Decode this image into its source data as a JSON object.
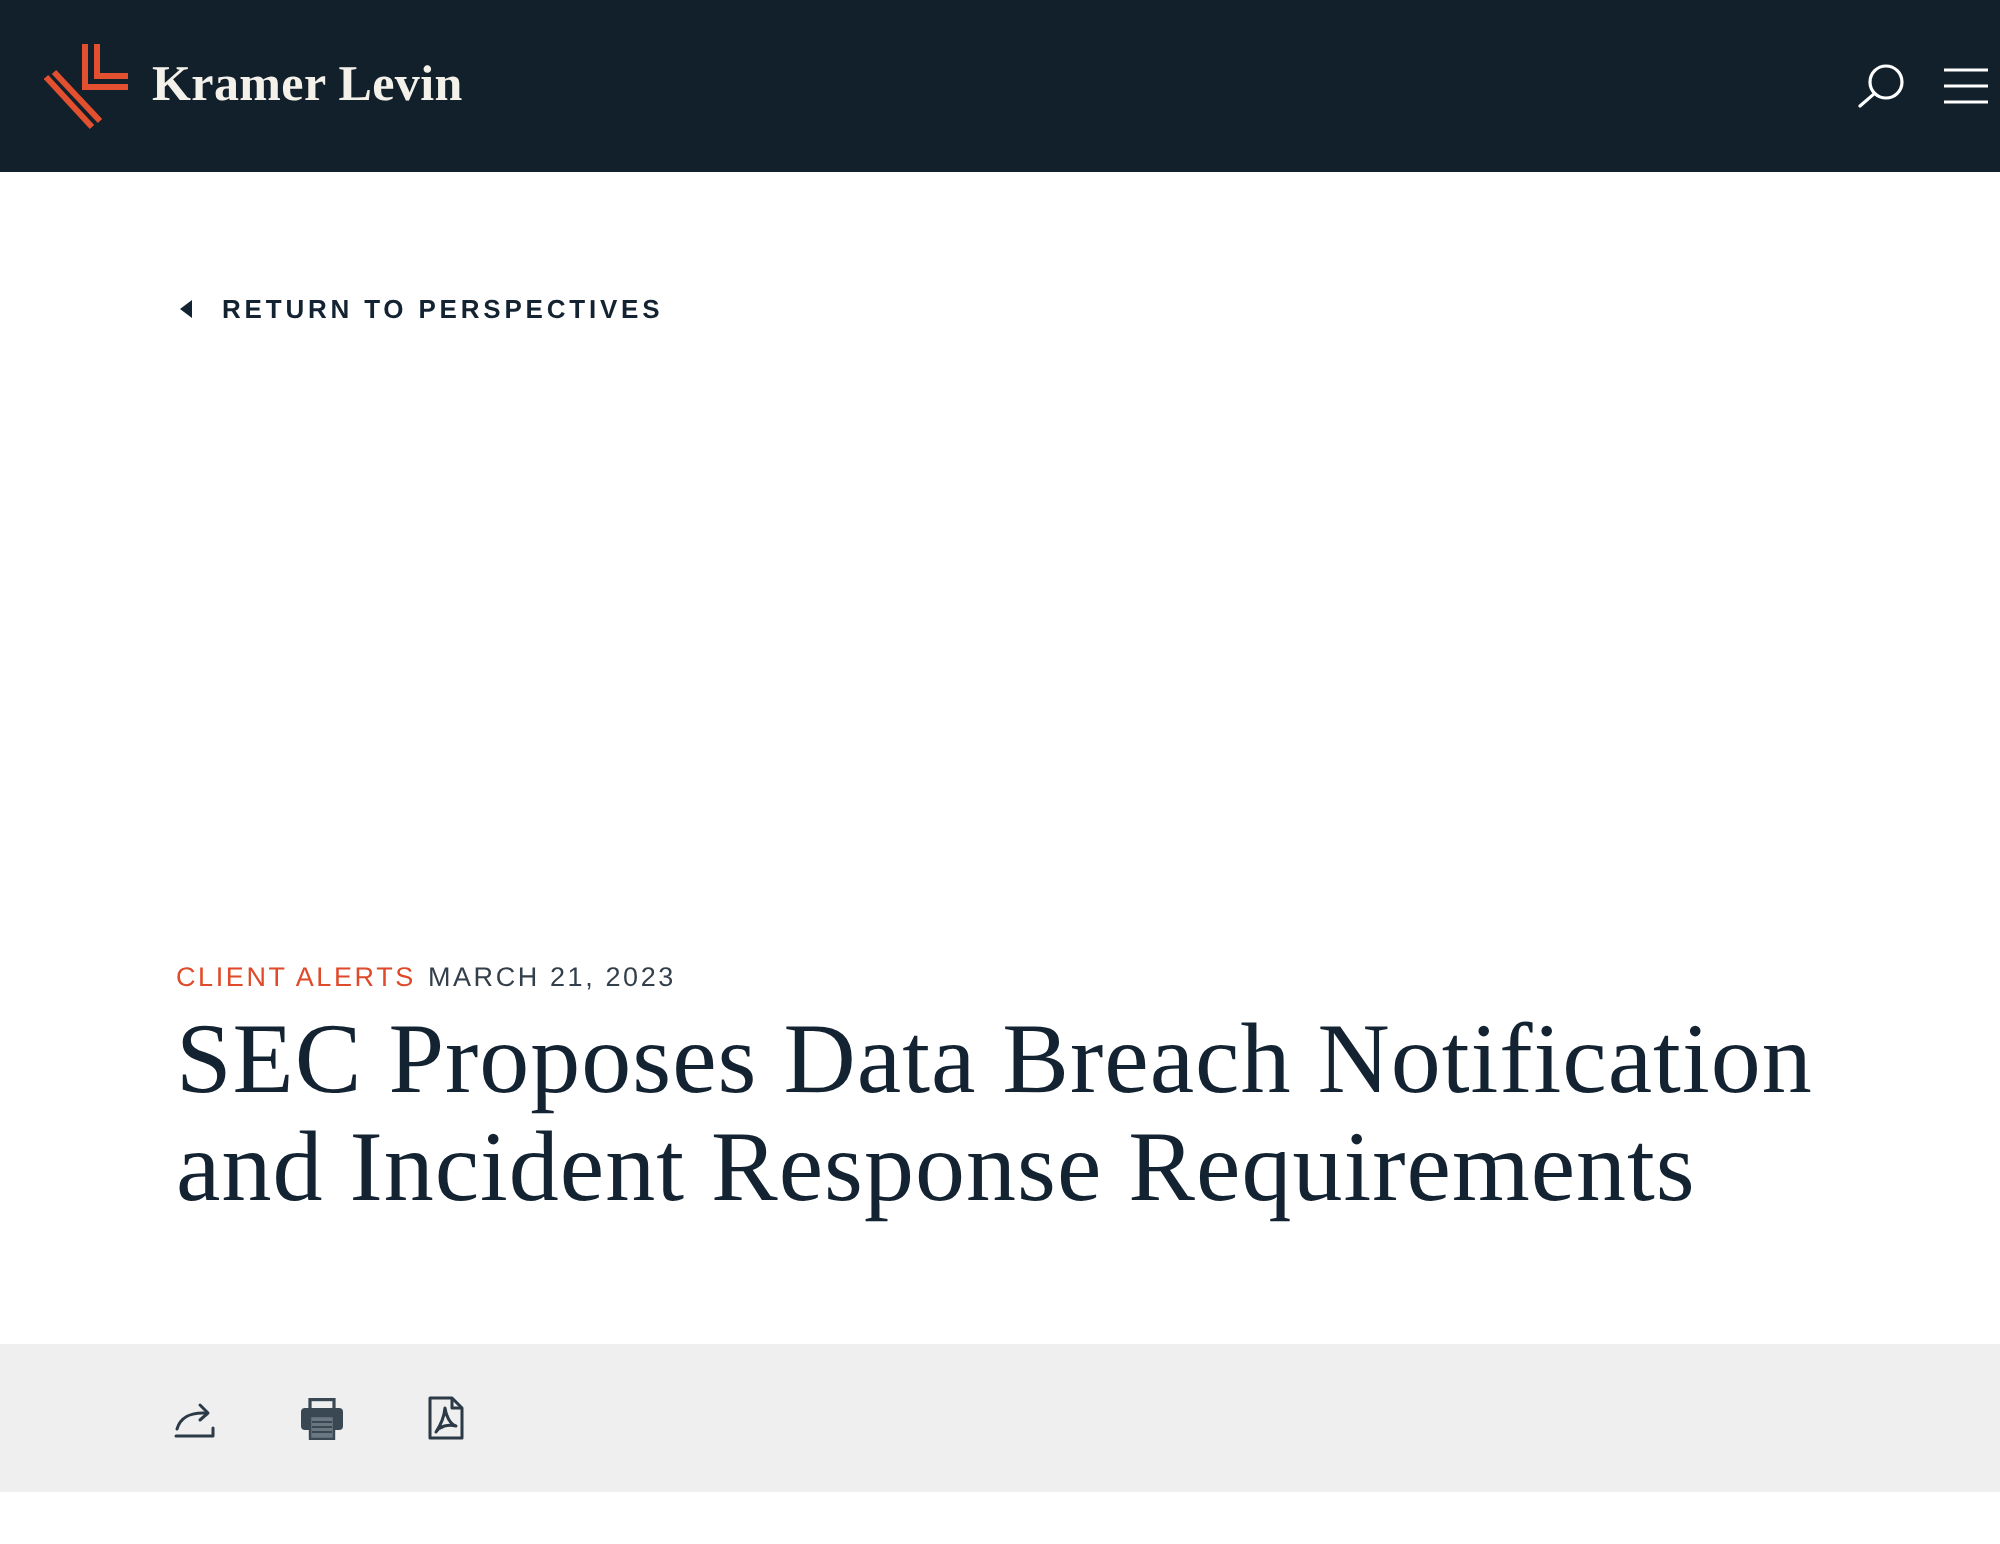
{
  "header": {
    "logo_text": "Kramer Levin"
  },
  "back_link": {
    "label": "RETURN TO PERSPECTIVES"
  },
  "article": {
    "category": "CLIENT ALERTS",
    "date": "MARCH 21, 2023",
    "title": "SEC Proposes Data Breach Notification and Incident Response Requirements"
  },
  "toolbar": {
    "actions": [
      {
        "kind": "share"
      },
      {
        "kind": "print"
      },
      {
        "kind": "pdf"
      }
    ]
  }
}
